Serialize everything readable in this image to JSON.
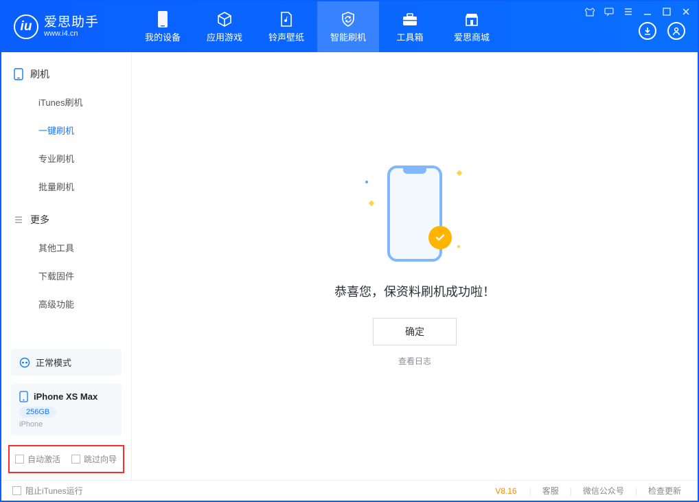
{
  "brand": {
    "name": "爱思助手",
    "url": "www.i4.cn",
    "logo_letter": "iu"
  },
  "topnav": {
    "items": [
      {
        "label": "我的设备"
      },
      {
        "label": "应用游戏"
      },
      {
        "label": "铃声壁纸"
      },
      {
        "label": "智能刷机"
      },
      {
        "label": "工具箱"
      },
      {
        "label": "爱思商城"
      }
    ],
    "active_index": 3
  },
  "sidebar": {
    "sections": [
      {
        "title": "刷机",
        "items": [
          "iTunes刷机",
          "一键刷机",
          "专业刷机",
          "批量刷机"
        ],
        "active_index": 1
      },
      {
        "title": "更多",
        "items": [
          "其他工具",
          "下载固件",
          "高级功能"
        ]
      }
    ]
  },
  "device": {
    "mode_label": "正常模式",
    "name": "iPhone XS Max",
    "capacity": "256GB",
    "type": "iPhone"
  },
  "options": {
    "auto_activate": "自动激活",
    "skip_guide": "跳过向导"
  },
  "result": {
    "title": "恭喜您，保资料刷机成功啦！",
    "ok_button": "确定",
    "view_log": "查看日志"
  },
  "statusbar": {
    "stop_itunes": "阻止iTunes运行",
    "version": "V8.16",
    "links": [
      "客服",
      "微信公众号",
      "检查更新"
    ]
  }
}
